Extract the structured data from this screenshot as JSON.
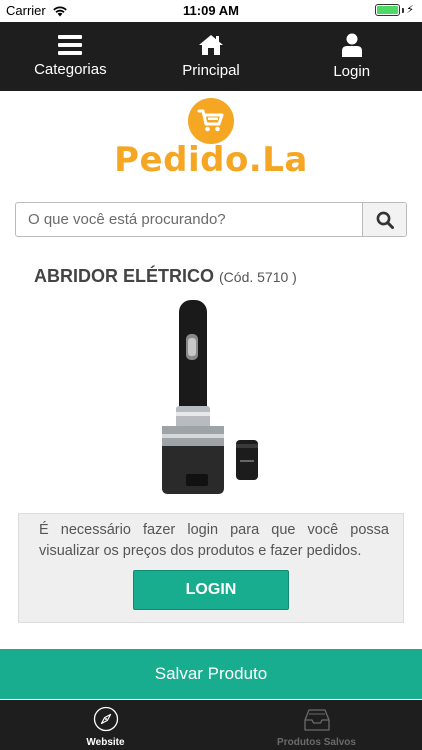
{
  "status_bar": {
    "carrier": "Carrier",
    "time": "11:09 AM",
    "battery_level": 1.0
  },
  "top_nav": {
    "items": [
      {
        "label": "Categorias",
        "icon": "menu-icon"
      },
      {
        "label": "Principal",
        "icon": "home-icon"
      },
      {
        "label": "Login",
        "icon": "user-icon"
      }
    ]
  },
  "brand": {
    "name": "Pedido.La",
    "icon": "shopping-cart-icon",
    "color": "#f5a623"
  },
  "search": {
    "placeholder": "O que você está procurando?",
    "value": ""
  },
  "product": {
    "title": "ABRIDOR ELÉTRICO",
    "code": "(Cód. 5710 )",
    "image_alt": "electric-wine-opener"
  },
  "login_notice": {
    "message": "É necessário fazer login para que você possa visualizar os preços dos produtos e fazer pedidos.",
    "button_label": "LOGIN"
  },
  "save_button": {
    "label": "Salvar Produto"
  },
  "tab_bar": {
    "tabs": [
      {
        "label": "Website",
        "icon": "compass-icon",
        "active": true
      },
      {
        "label": "Produtos Salvos",
        "icon": "inbox-tray-icon",
        "active": false
      }
    ]
  },
  "colors": {
    "accent": "#19ad8f",
    "nav_bg": "#1e1e1e",
    "brand": "#f5a623"
  }
}
